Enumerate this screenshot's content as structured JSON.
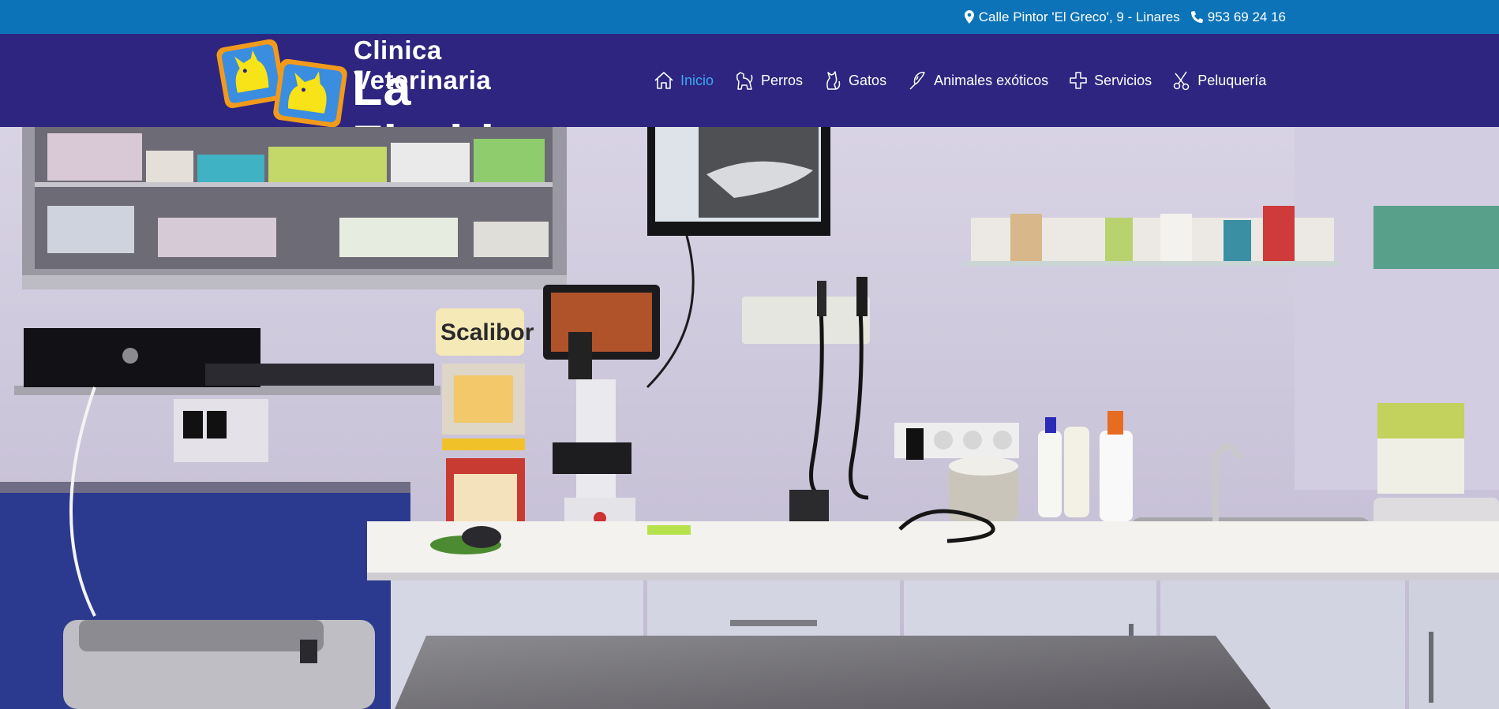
{
  "topbar": {
    "address": "Calle Pintor 'El Greco', 9 - Linares",
    "phone": "953 69 24 16"
  },
  "logo": {
    "line1": "Clinica Veterinaria",
    "line2": "La Florida"
  },
  "nav": {
    "items": [
      {
        "label": "Inicio",
        "icon": "house-icon",
        "active": true
      },
      {
        "label": "Perros",
        "icon": "dog-icon",
        "active": false
      },
      {
        "label": "Gatos",
        "icon": "cat-icon",
        "active": false
      },
      {
        "label": "Animales exóticos",
        "icon": "bird-icon",
        "active": false
      },
      {
        "label": "Servicios",
        "icon": "plus-cross-icon",
        "active": false
      },
      {
        "label": "Peluquería",
        "icon": "scissors-icon",
        "active": false
      }
    ]
  },
  "hero": {
    "label_scalibor": "Scalibor"
  },
  "colors": {
    "topbar": "#0c73b8",
    "header": "#2e2580",
    "active_nav": "#3ba6f2",
    "logo_yellow": "#f7e317",
    "logo_orange": "#f29a1b"
  }
}
